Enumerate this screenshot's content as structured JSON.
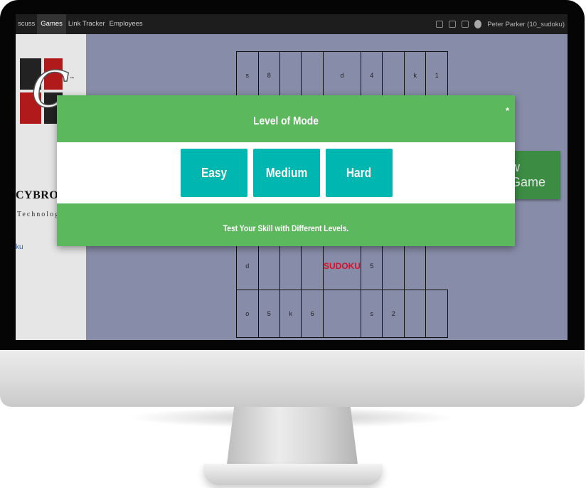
{
  "topbar": {
    "nav": [
      "scuss",
      "Games",
      "Link Tracker",
      "Employees"
    ],
    "active": "Games",
    "user": "Peter Parker (10_sudoku)"
  },
  "sidebar": {
    "brand": "CYBROS",
    "brand_sub": "Technolog",
    "tm": "™",
    "link": "ku"
  },
  "new_game_label": "w Game",
  "grid": {
    "top_row": [
      "s",
      "8",
      "",
      "",
      "d",
      "4",
      "",
      "k",
      "1"
    ],
    "row_mid": [
      "d",
      "",
      "",
      "",
      "SUDOKU",
      "",
      "5",
      "",
      "",
      ""
    ],
    "row_bottom": [
      "o",
      "5",
      "k",
      "6",
      "",
      "s",
      "2",
      "",
      ""
    ]
  },
  "modal": {
    "title": "Level of Mode",
    "close": "*",
    "buttons": [
      "Easy",
      "Medium",
      "Hard"
    ],
    "tagline": "Test Your Skill with Different Levels."
  },
  "colors": {
    "modal_green": "#5cb85c",
    "button_teal": "#00b6b0",
    "new_game_green": "#3c8c43",
    "screen_bg": "#878ca8",
    "sudoku_red": "#d8102a"
  }
}
